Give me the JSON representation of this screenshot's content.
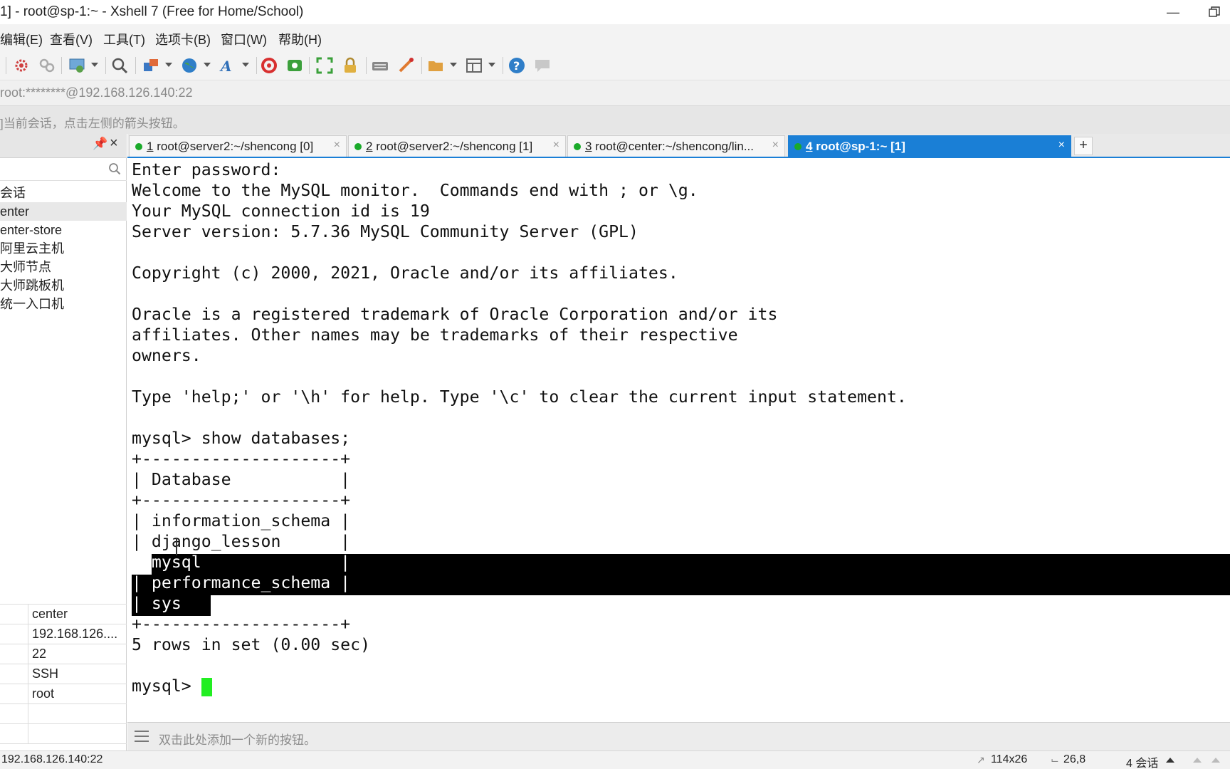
{
  "window": {
    "title": "1] - root@sp-1:~ - Xshell 7 (Free for Home/School)"
  },
  "menu": {
    "items": [
      "编辑(E)",
      "查看(V)",
      "工具(T)",
      "选项卡(B)",
      "窗口(W)",
      "帮助(H)"
    ]
  },
  "toolbar": {
    "icons": [
      "properties-icon",
      "link-icon",
      "settings-icon",
      "search-icon",
      "transfer-icon",
      "globe-icon",
      "font-icon",
      "xftp-icon",
      "xmanager-icon",
      "fullscreen-icon",
      "lock-icon",
      "keyboard-icon",
      "script-icon",
      "folder-icon",
      "layout-icon",
      "help-icon",
      "chat-icon"
    ]
  },
  "address": {
    "text": "root:********@192.168.126.140:22"
  },
  "hint": {
    "text": "]当前会话，点击左侧的箭头按钮。"
  },
  "sessions": {
    "search_placeholder": "",
    "items": [
      "会话",
      "enter",
      "enter-store",
      "阿里云主机",
      "大师节点",
      "大师跳板机",
      "统一入口机"
    ]
  },
  "properties": {
    "values": [
      "center",
      "192.168.126....",
      "22",
      "SSH",
      "root",
      "",
      ""
    ]
  },
  "tabs": [
    {
      "num": "1",
      "label": "root@server2:~/shencong [0]",
      "active": false
    },
    {
      "num": "2",
      "label": "root@server2:~/shencong [1]",
      "active": false
    },
    {
      "num": "3",
      "label": "root@center:~/shencong/lin...",
      "active": false
    },
    {
      "num": "4",
      "label": "root@sp-1:~ [1]",
      "active": true
    }
  ],
  "terminal": {
    "lines": [
      "Enter password:",
      "Welcome to the MySQL monitor.  Commands end with ; or \\g.",
      "Your MySQL connection id is 19",
      "Server version: 5.7.36 MySQL Community Server (GPL)",
      "",
      "Copyright (c) 2000, 2021, Oracle and/or its affiliates.",
      "",
      "Oracle is a registered trademark of Oracle Corporation and/or its",
      "affiliates. Other names may be trademarks of their respective",
      "owners.",
      "",
      "Type 'help;' or '\\h' for help. Type '\\c' to clear the current input statement.",
      "",
      "mysql> show databases;",
      "+--------------------+",
      "| Database           |",
      "+--------------------+",
      "| information_schema |",
      "| django_lesson      |",
      "| mysql              |",
      "| performance_schema |",
      "| sys                |",
      "+--------------------+",
      "5 rows in set (0.00 sec)",
      "",
      "mysql> "
    ]
  },
  "quickbar": {
    "text": "双击此处添加一个新的按钮。"
  },
  "status": {
    "address": "192.168.126.140:22",
    "size": "114x26",
    "position": "26,8",
    "sessions": "4 会话"
  }
}
